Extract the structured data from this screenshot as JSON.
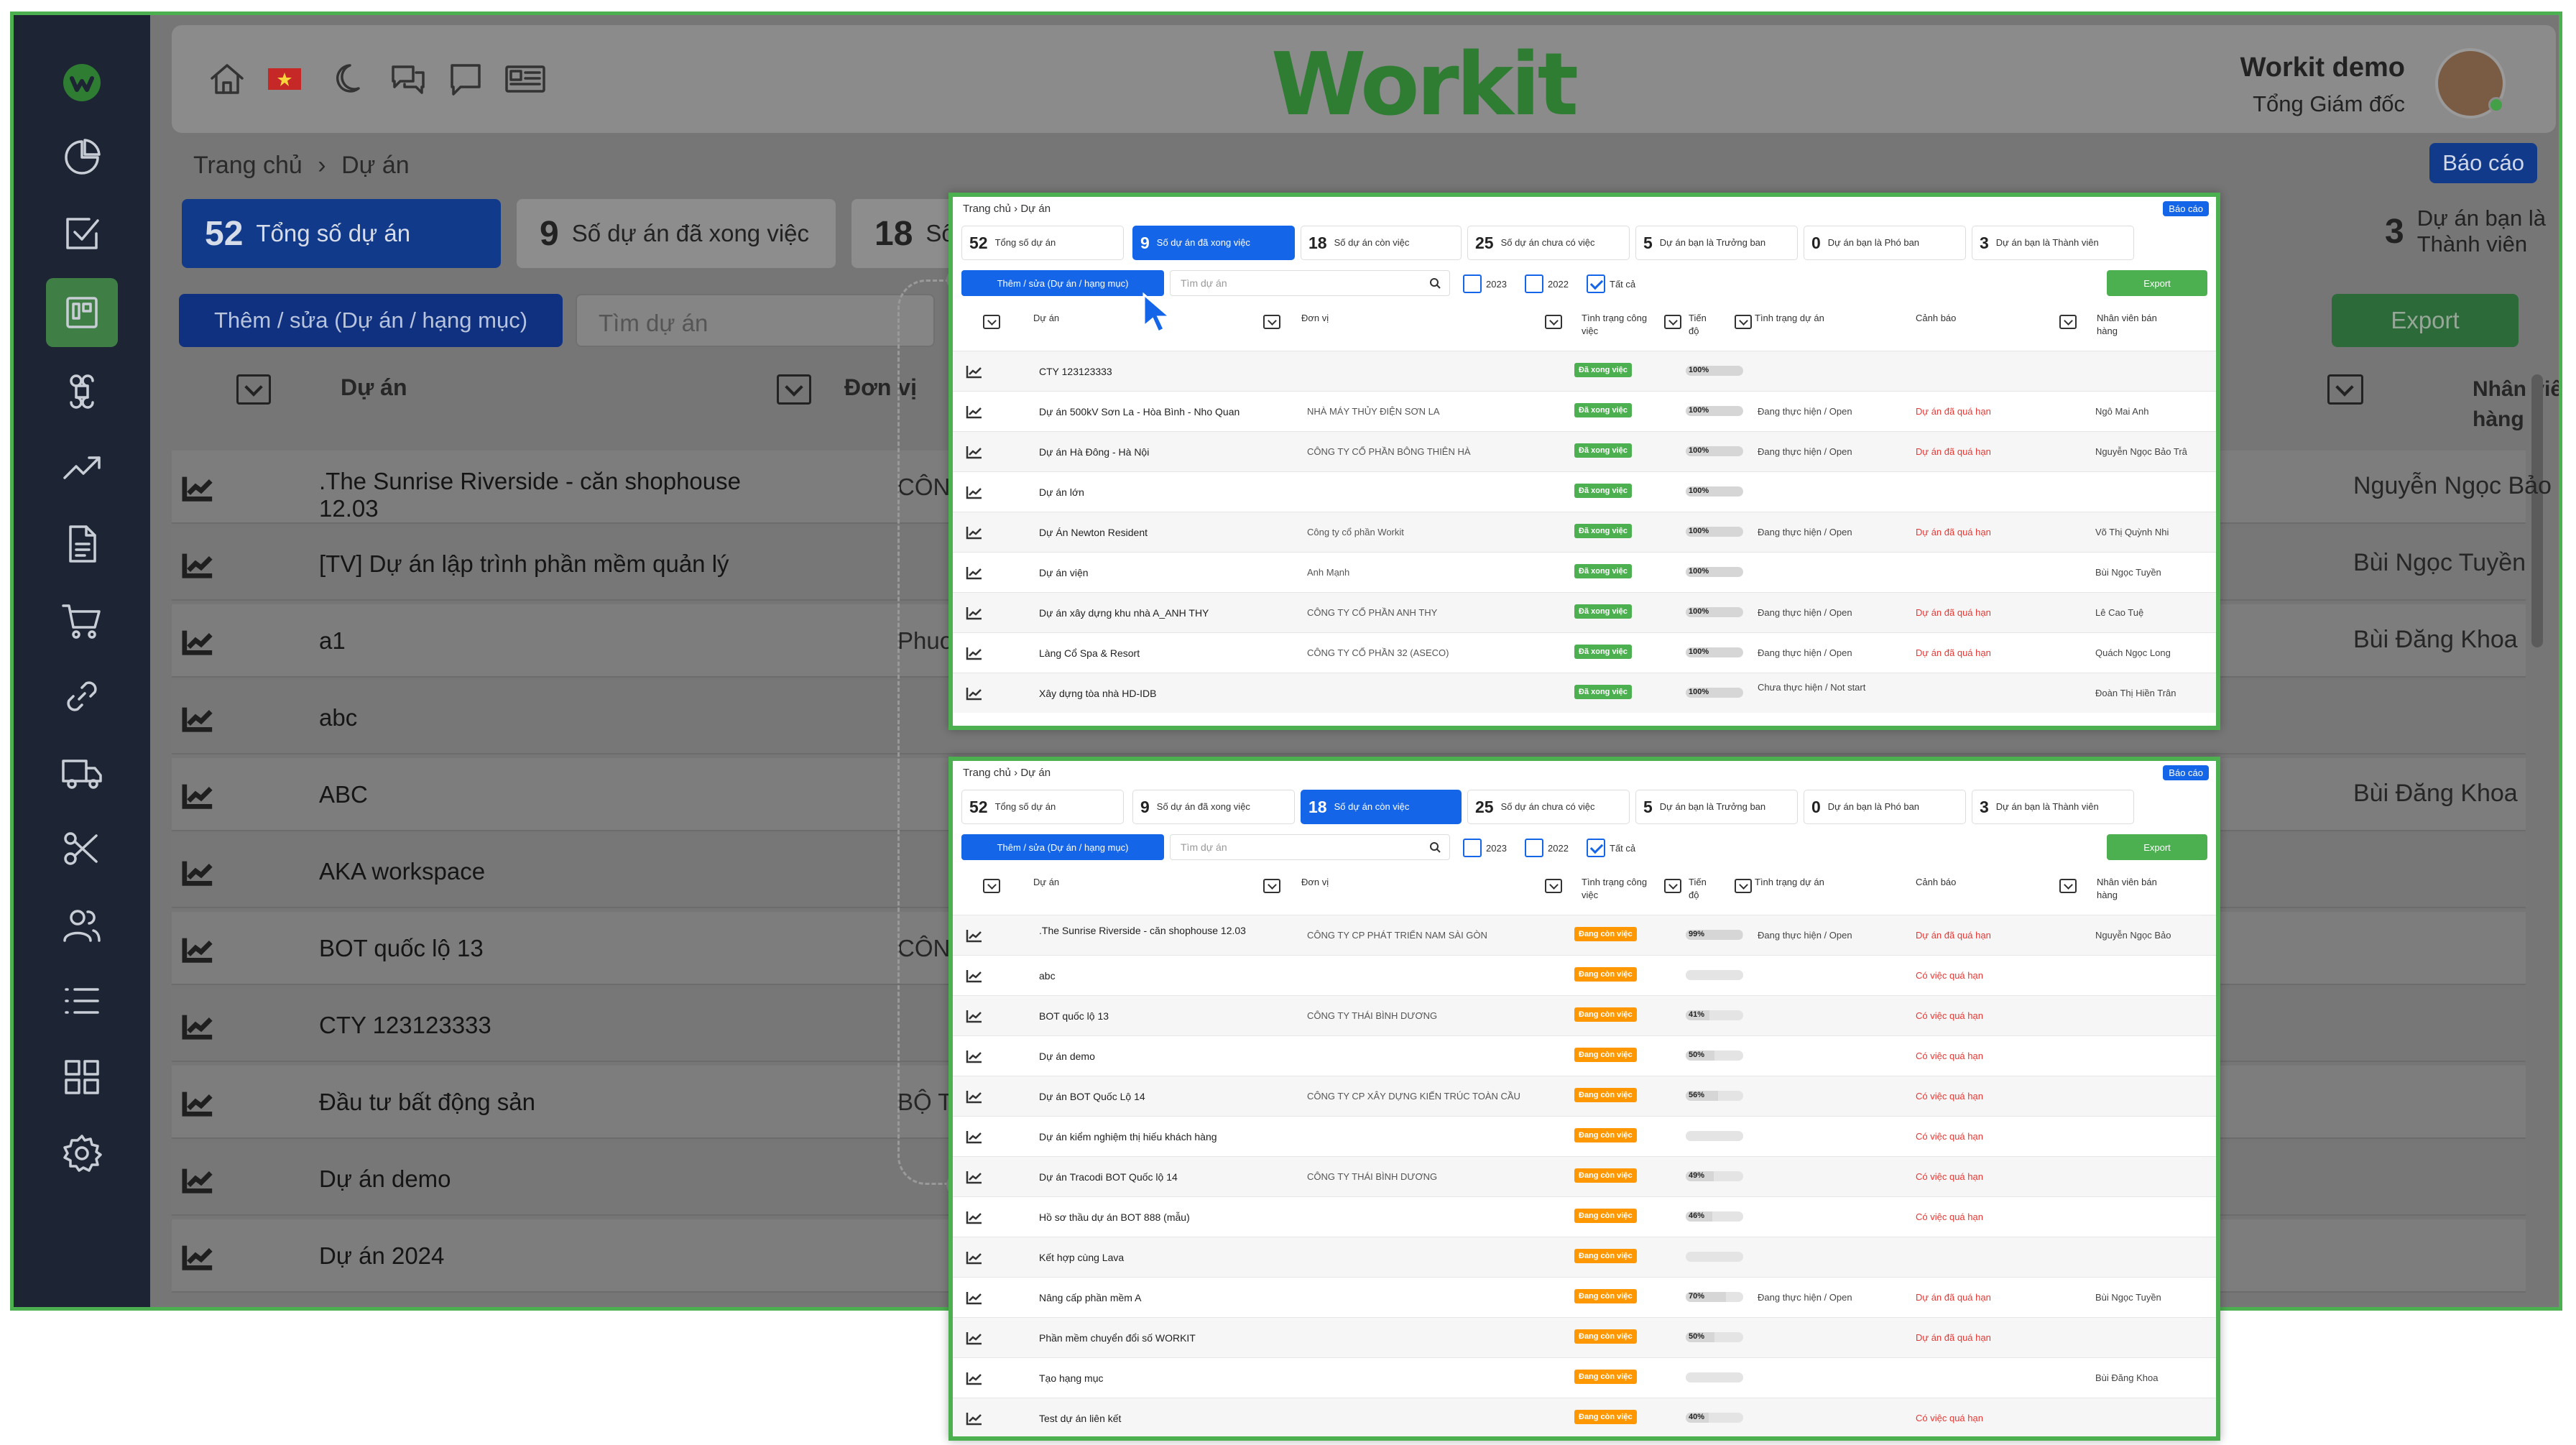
{
  "user": {
    "name": "Workit demo",
    "role": "Tổng Giám đốc"
  },
  "logo": "Workit",
  "breadcrumb": {
    "home": "Trang chủ",
    "sep": "›",
    "current": "Dự án"
  },
  "report_button": "Báo cáo",
  "stats": [
    {
      "num": "52",
      "label": "Tổng số dự án"
    },
    {
      "num": "9",
      "label": "Số dự án đã xong việc"
    },
    {
      "num": "18",
      "label": "Số dự án còn việc"
    },
    {
      "num": "25",
      "label": "Số dự án chưa có việc"
    },
    {
      "num": "5",
      "label": "Dự án bạn là Trưởng ban"
    },
    {
      "num": "0",
      "label": "Dự án bạn là Phó ban"
    },
    {
      "num": "3",
      "label": "Dự án bạn là Thành viên"
    }
  ],
  "toolbar": {
    "add": "Thêm / sửa (Dự án / hạng mục)",
    "search_placeholder": "Tìm dự án",
    "export": "Export",
    "years": [
      "2023",
      "2022",
      "Tất cả"
    ]
  },
  "columns": {
    "project": "Dự án",
    "unit": "Đơn vị",
    "status": "Tình trạng công việc",
    "progress": "Tiến độ",
    "project_status": "Tình trạng dự án",
    "warning": "Cảnh báo",
    "sales": "Nhân viên bán hàng"
  },
  "background_rows": [
    {
      "name": ".The Sunrise Riverside - căn shophouse 12.03",
      "unit": "CÔNG TY C",
      "sales": "Nguyễn Ngọc Bảo"
    },
    {
      "name": "[TV] Dự án lập trình phần mềm quản lý",
      "unit": "",
      "sales": "Bùi Ngọc Tuyền"
    },
    {
      "name": "a1",
      "unit": "Phuong",
      "sales": "Bùi Đăng Khoa"
    },
    {
      "name": "abc",
      "unit": "",
      "sales": ""
    },
    {
      "name": "ABC",
      "unit": "",
      "sales": "Bùi Đăng Khoa"
    },
    {
      "name": "AKA workspace",
      "unit": "",
      "sales": ""
    },
    {
      "name": "BOT quốc lộ 13",
      "unit": "CÔNG TY T",
      "sales": ""
    },
    {
      "name": "CTY 123123333",
      "unit": "",
      "sales": ""
    },
    {
      "name": "Đầu tư bất động sản",
      "unit": "BỘ THÔNG",
      "sales": ""
    },
    {
      "name": "Dự án demo",
      "unit": "",
      "sales": ""
    },
    {
      "name": "Dự án 2024",
      "unit": "",
      "sales": ""
    }
  ],
  "panel1_rows": [
    {
      "name": "CTY 123123333",
      "unit": "",
      "status": "Đã xong việc",
      "progress": "100%",
      "pstatus": "",
      "warn": "",
      "sales": ""
    },
    {
      "name": "Dự án 500kV Sơn La - Hòa Bình - Nho Quan",
      "unit": "NHÀ MÁY THỦY ĐIỆN SƠN LA",
      "status": "Đã xong việc",
      "progress": "100%",
      "pstatus": "Đang thực hiện / Open",
      "warn": "Dự án đã quá hạn",
      "sales": "Ngô Mai Anh"
    },
    {
      "name": "Dự án Hà Đông - Hà Nội",
      "unit": "CÔNG TY CỔ PHẦN BÔNG THIÊN HÀ",
      "status": "Đã xong việc",
      "progress": "100%",
      "pstatus": "Đang thực hiện / Open",
      "warn": "Dự án đã quá hạn",
      "sales": "Nguyễn Ngọc Bảo Trâ"
    },
    {
      "name": "Dự án lớn",
      "unit": "",
      "status": "Đã xong việc",
      "progress": "100%",
      "pstatus": "",
      "warn": "",
      "sales": ""
    },
    {
      "name": "Dự Án Newton Resident",
      "unit": "Công ty cổ phần Workit",
      "status": "Đã xong việc",
      "progress": "100%",
      "pstatus": "Đang thực hiện / Open",
      "warn": "Dự án đã quá hạn",
      "sales": "Võ Thị Quỳnh Nhi"
    },
    {
      "name": "Dự án viện",
      "unit": "Anh Mạnh",
      "status": "Đã xong việc",
      "progress": "100%",
      "pstatus": "",
      "warn": "",
      "sales": "Bùi Ngọc Tuyền"
    },
    {
      "name": "Dự án xây dựng khu nhà A_ANH THY",
      "unit": "CÔNG TY CỔ PHẦN ANH THY",
      "status": "Đã xong việc",
      "progress": "100%",
      "pstatus": "Đang thực hiện / Open",
      "warn": "Dự án đã quá hạn",
      "sales": "Lê Cao Tuệ"
    },
    {
      "name": "Làng Cổ Spa & Resort",
      "unit": "CÔNG TY CỔ PHẦN 32 (ASECO)",
      "status": "Đã xong việc",
      "progress": "100%",
      "pstatus": "Đang thực hiện / Open",
      "warn": "Dự án đã quá hạn",
      "sales": "Quách Ngọc Long"
    },
    {
      "name": "Xây dựng tòa nhà HD-IDB",
      "unit": "",
      "status": "Đã xong việc",
      "progress": "100%",
      "pstatus": "Chưa thực hiện / Not start",
      "warn": "",
      "sales": "Đoàn Thị Hiền Trân"
    }
  ],
  "panel2_rows": [
    {
      "name": ".The Sunrise Riverside - căn shophouse 12.03",
      "unit": "CÔNG TY CP PHÁT TRIỂN NAM SÀI GÒN",
      "status": "Đang còn việc",
      "progress": "99%",
      "pct": 99,
      "pstatus": "Đang thực hiện / Open",
      "warn": "Dự án đã quá hạn",
      "sales": "Nguyễn Ngọc Bảo"
    },
    {
      "name": "abc",
      "unit": "",
      "status": "Đang còn việc",
      "progress": "",
      "pct": 0,
      "pstatus": "",
      "warn": "Có việc quá hạn",
      "sales": ""
    },
    {
      "name": "BOT quốc lộ 13",
      "unit": "CÔNG TY THÁI BÌNH DƯƠNG",
      "status": "Đang còn việc",
      "progress": "41%",
      "pct": 41,
      "pstatus": "",
      "warn": "Có việc quá hạn",
      "sales": ""
    },
    {
      "name": "Dự án demo",
      "unit": "",
      "status": "Đang còn việc",
      "progress": "50%",
      "pct": 50,
      "pstatus": "",
      "warn": "Có việc quá hạn",
      "sales": ""
    },
    {
      "name": "Dự án BOT Quốc Lộ 14",
      "unit": "CÔNG TY CP XÂY DỰNG KIẾN TRÚC TOÀN CẦU",
      "status": "Đang còn việc",
      "progress": "56%",
      "pct": 56,
      "pstatus": "",
      "warn": "Có việc quá hạn",
      "sales": ""
    },
    {
      "name": "Dự án kiểm nghiệm thị hiếu khách hàng",
      "unit": "",
      "status": "Đang còn việc",
      "progress": "",
      "pct": 0,
      "pstatus": "",
      "warn": "Có việc quá hạn",
      "sales": ""
    },
    {
      "name": "Dự án Tracodi BOT Quốc lộ 14",
      "unit": "CÔNG TY THÁI BÌNH DƯƠNG",
      "status": "Đang còn việc",
      "progress": "49%",
      "pct": 49,
      "pstatus": "",
      "warn": "Có việc quá hạn",
      "sales": ""
    },
    {
      "name": "Hồ sơ thầu dự án BOT 888 (mẫu)",
      "unit": "",
      "status": "Đang còn việc",
      "progress": "46%",
      "pct": 46,
      "pstatus": "",
      "warn": "Có việc quá hạn",
      "sales": ""
    },
    {
      "name": "Kết hợp cùng Lava",
      "unit": "",
      "status": "Đang còn việc",
      "progress": "",
      "pct": 0,
      "pstatus": "",
      "warn": "",
      "sales": ""
    },
    {
      "name": "Nâng cấp phần mềm A",
      "unit": "",
      "status": "Đang còn việc",
      "progress": "70%",
      "pct": 70,
      "pstatus": "Đang thực hiện / Open",
      "warn": "Dự án đã quá hạn",
      "sales": "Bùi Ngọc Tuyền"
    },
    {
      "name": "Phần mềm chuyển đổi số WORKIT",
      "unit": "",
      "status": "Đang còn việc",
      "progress": "50%",
      "pct": 50,
      "pstatus": "",
      "warn": "Dự án đã quá hạn",
      "sales": ""
    },
    {
      "name": "Tạo hạng mục",
      "unit": "",
      "status": "Đang còn việc",
      "progress": "",
      "pct": 0,
      "pstatus": "",
      "warn": "",
      "sales": "Bùi Đăng Khoa"
    },
    {
      "name": "Test dự án liên kết",
      "unit": "",
      "status": "Đang còn việc",
      "progress": "40%",
      "pct": 40,
      "pstatus": "",
      "warn": "Có việc quá hạn",
      "sales": ""
    }
  ],
  "colors": {
    "primary": "#1565e8",
    "success": "#4caf50",
    "warning": "#ff9800",
    "danger": "#e53935",
    "sidebar": "#1d2433"
  }
}
